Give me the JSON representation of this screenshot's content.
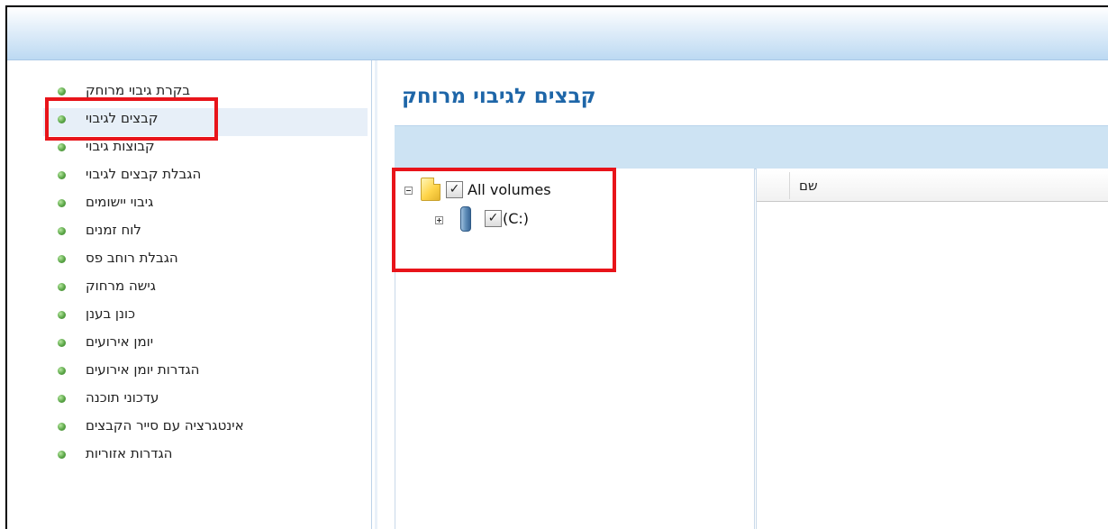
{
  "sidebar": {
    "items": [
      {
        "label": "בקרת גיבוי מרוחק"
      },
      {
        "label": "קבצים לגיבוי",
        "selected": true
      },
      {
        "label": "קבוצות גיבוי"
      },
      {
        "label": "הגבלת קבצים לגיבוי"
      },
      {
        "label": "גיבוי יישומים"
      },
      {
        "label": "לוח זמנים"
      },
      {
        "label": "הגבלת רוחב פס"
      },
      {
        "label": "גישה מרחוק"
      },
      {
        "label": "כונן בענן"
      },
      {
        "label": "יומן אירועים"
      },
      {
        "label": "הגדרות יומן אירועים"
      },
      {
        "label": "עדכוני תוכנה"
      },
      {
        "label": "אינטגרציה עם סייר הקבצים"
      },
      {
        "label": "הגדרות אזוריות"
      }
    ]
  },
  "main": {
    "title": "קבצים לגיבוי מרוחק",
    "tree": {
      "root": {
        "label": "All volumes",
        "checked": true,
        "expanded": true
      },
      "children": [
        {
          "label": "(C:)",
          "checked": true,
          "expanded": false
        }
      ]
    },
    "list": {
      "column_name": "שם"
    }
  },
  "colors": {
    "accent_title": "#1e66a8",
    "highlight": "#e8141a",
    "bullet": "#5aa646"
  }
}
